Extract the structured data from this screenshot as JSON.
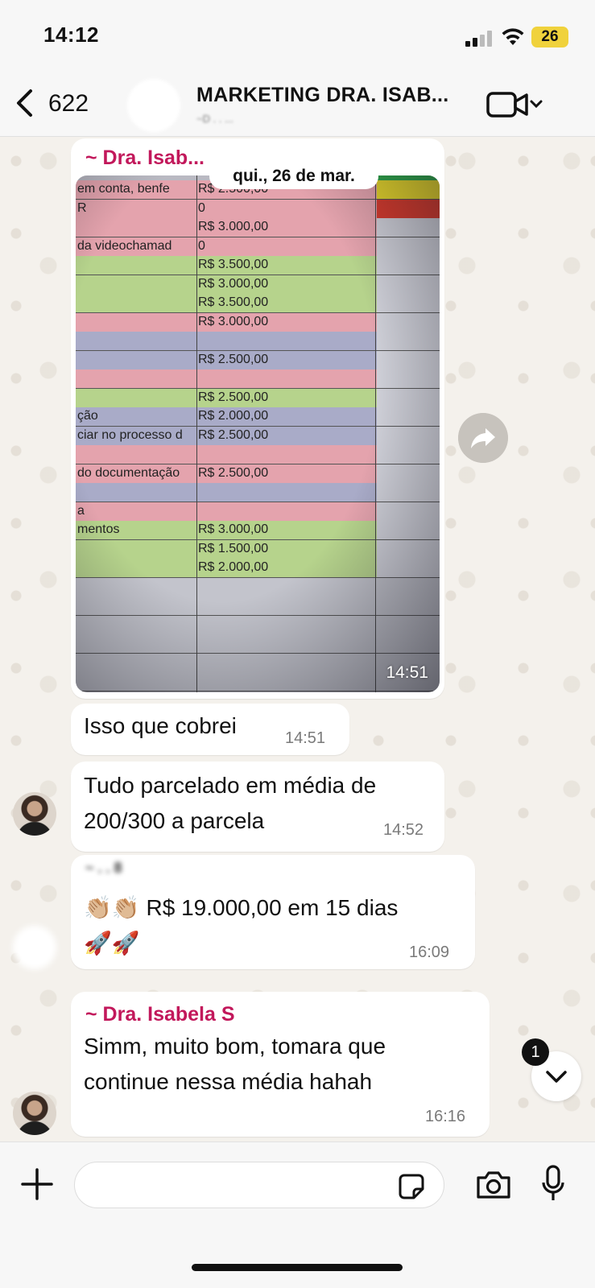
{
  "status_bar": {
    "time": "14:12",
    "battery": "26"
  },
  "header": {
    "back_count": "622",
    "title": "MARKETING DRA. ISAB...",
    "subtitle": "~D . . ..."
  },
  "messages": {
    "photo_msg": {
      "sender": "~ Dra. Isab...",
      "date_chip": "qui., 26 de mar.",
      "time": "14:51",
      "sheet_rows": [
        {
          "a": "em conta, benfe",
          "b": "R$ 2.500,00",
          "color": "#e4a3ad",
          "status": "#e7d72a"
        },
        {
          "a": "R",
          "b": "0",
          "color": "#e4a3ad",
          "status": "#d63a2c"
        },
        {
          "a": "",
          "b": "R$ 3.000,00",
          "color": "#e4a3ad",
          "status": ""
        },
        {
          "a": "da videochamad",
          "b": "0",
          "color": "#e4a3ad",
          "status": ""
        },
        {
          "a": "",
          "b": "R$ 3.500,00",
          "color": "#b6d38c",
          "status": ""
        },
        {
          "a": "",
          "b": "R$ 3.000,00",
          "color": "#b6d38c",
          "status": ""
        },
        {
          "a": "",
          "b": "R$ 3.500,00",
          "color": "#b6d38c",
          "status": ""
        },
        {
          "a": "",
          "b": "R$ 3.000,00",
          "color": "#e4a3ad",
          "status": ""
        },
        {
          "a": "",
          "b": "",
          "color": "#a9abc8",
          "status": ""
        },
        {
          "a": "",
          "b": "R$ 2.500,00",
          "color": "#a9abc8",
          "status": ""
        },
        {
          "a": "",
          "b": "",
          "color": "#e4a3ad",
          "status": ""
        },
        {
          "a": "",
          "b": "R$ 2.500,00",
          "color": "#b6d38c",
          "status": ""
        },
        {
          "a": "ção",
          "b": "R$ 2.000,00",
          "color": "#a9abc8",
          "status": ""
        },
        {
          "a": "ciar no processo d",
          "b": "R$ 2.500,00",
          "color": "#a9abc8",
          "status": ""
        },
        {
          "a": "",
          "b": "",
          "color": "#e4a3ad",
          "status": ""
        },
        {
          "a": "do documentação",
          "b": "R$ 2.500,00",
          "color": "#e4a3ad",
          "status": ""
        },
        {
          "a": "",
          "b": "",
          "color": "#a9abc8",
          "status": ""
        },
        {
          "a": "a",
          "b": "",
          "color": "#e4a3ad",
          "status": ""
        },
        {
          "a": "mentos",
          "b": "R$ 3.000,00",
          "color": "#b6d38c",
          "status": ""
        },
        {
          "a": "",
          "b": "R$ 1.500,00",
          "color": "#b6d38c",
          "status": ""
        },
        {
          "a": "",
          "b": "R$ 2.000,00",
          "color": "#b6d38c",
          "status": ""
        }
      ]
    },
    "msg1": {
      "text": "Isso que cobrei",
      "time": "14:51"
    },
    "msg2": {
      "text": "Tudo parcelado em média de 200/300 a parcela",
      "time": "14:52"
    },
    "msg3": {
      "sender": "~ . . 8",
      "text": "👏🏼👏🏼 R$ 19.000,00 em 15 dias",
      "text2": "🚀🚀",
      "time": "16:09"
    },
    "msg4": {
      "sender": "~ Dra. Isabela S",
      "text": "Simm, muito bom, tomara que continue nessa média hahah",
      "time": "16:16"
    }
  },
  "unread_count": "1",
  "input": {
    "placeholder": ""
  },
  "icons": {
    "back": "chevron-left-icon",
    "video": "video-camera-icon",
    "forward": "forward-arrow-icon",
    "scroll_down": "chevron-down-icon",
    "plus": "plus-icon",
    "sticker": "sticker-icon",
    "camera": "camera-icon",
    "mic": "microphone-icon"
  },
  "colors": {
    "sender": "#c2185b",
    "bubble": "#ffffff",
    "wallpaper": "#f4f1ec"
  }
}
